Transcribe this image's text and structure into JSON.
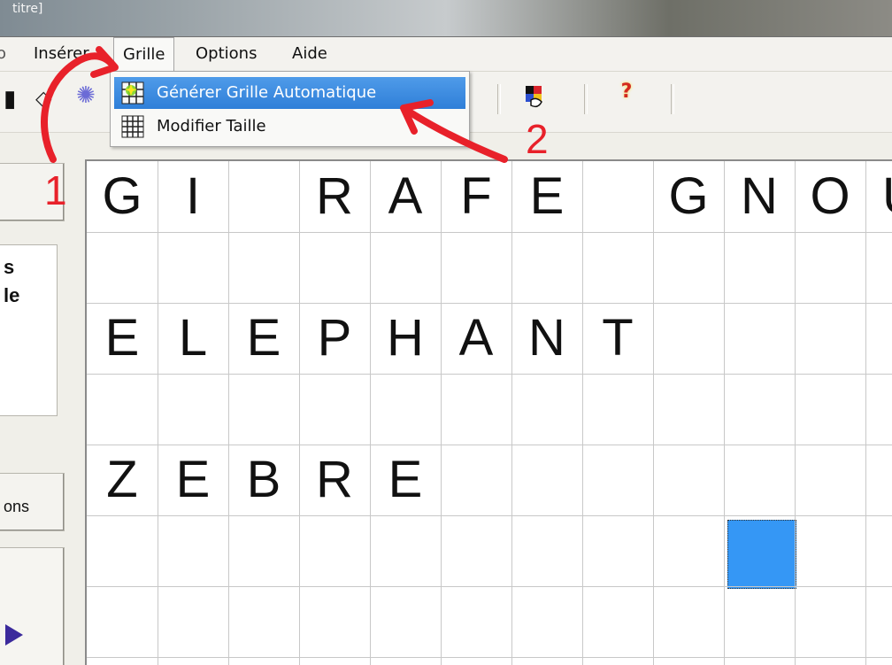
{
  "window": {
    "title": "titre]"
  },
  "menubar": {
    "items": [
      {
        "label": "Insérer"
      },
      {
        "label": "Grille"
      },
      {
        "label": "Options"
      },
      {
        "label": "Aide"
      }
    ]
  },
  "dropdown": {
    "items": [
      {
        "label": "Générer Grille Automatique",
        "icon": "generate-grid-icon"
      },
      {
        "label": "Modifier Taille",
        "icon": "grid-size-icon"
      }
    ]
  },
  "toolbar": {
    "help_glyph": "?"
  },
  "left_panel": {
    "text_line1": "s",
    "text_line2": "le",
    "button_label": "ons"
  },
  "grid": {
    "rows": [
      [
        "G",
        "I",
        "",
        "R",
        "A",
        "F",
        "E",
        "",
        "G",
        "N",
        "O",
        "U"
      ],
      [
        "",
        "",
        "",
        "",
        "",
        "",
        "",
        "",
        "",
        "",
        "",
        ""
      ],
      [
        "E",
        "L",
        "E",
        "P",
        "H",
        "A",
        "N",
        "T",
        "",
        "",
        "",
        ""
      ],
      [
        "",
        "",
        "",
        "",
        "",
        "",
        "",
        "",
        "",
        "",
        "",
        ""
      ],
      [
        "Z",
        "E",
        "B",
        "R",
        "E",
        "",
        "",
        "",
        "",
        "",
        "",
        ""
      ],
      [
        "",
        "",
        "",
        "",
        "",
        "",
        "",
        "",
        "",
        "",
        "",
        ""
      ],
      [
        "",
        "",
        "",
        "",
        "",
        "",
        "",
        "",
        "",
        "",
        "",
        ""
      ]
    ],
    "selected_cell_color": "#3597f5"
  },
  "annotations": {
    "arrow1_label": "1",
    "arrow2_label": "2",
    "color": "#e8212a"
  }
}
